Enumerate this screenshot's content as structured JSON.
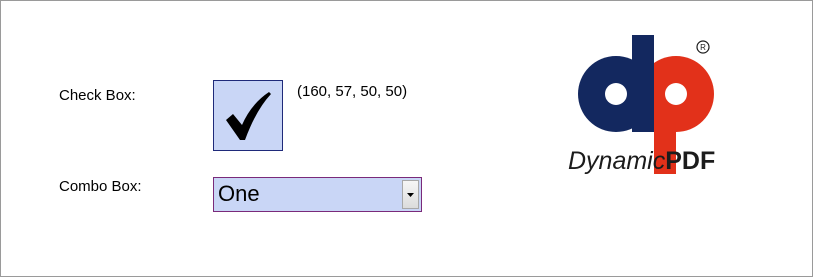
{
  "form": {
    "checkbox_label": "Check Box:",
    "checkbox_checked": true,
    "checkbox_coords": "(160, 57, 50, 50)",
    "combo_label": "Combo Box:",
    "combo_value": "One"
  },
  "logo": {
    "name_part1": "Dynamic",
    "name_part2": "PDF",
    "registered_mark": "®"
  },
  "colors": {
    "field_background": "#c9d6f6",
    "logo_navy": "#13285f",
    "logo_red": "#e2311a"
  },
  "icons": {
    "checkbox": "checkmark-icon",
    "combo_button": "dropdown-arrow-icon"
  }
}
